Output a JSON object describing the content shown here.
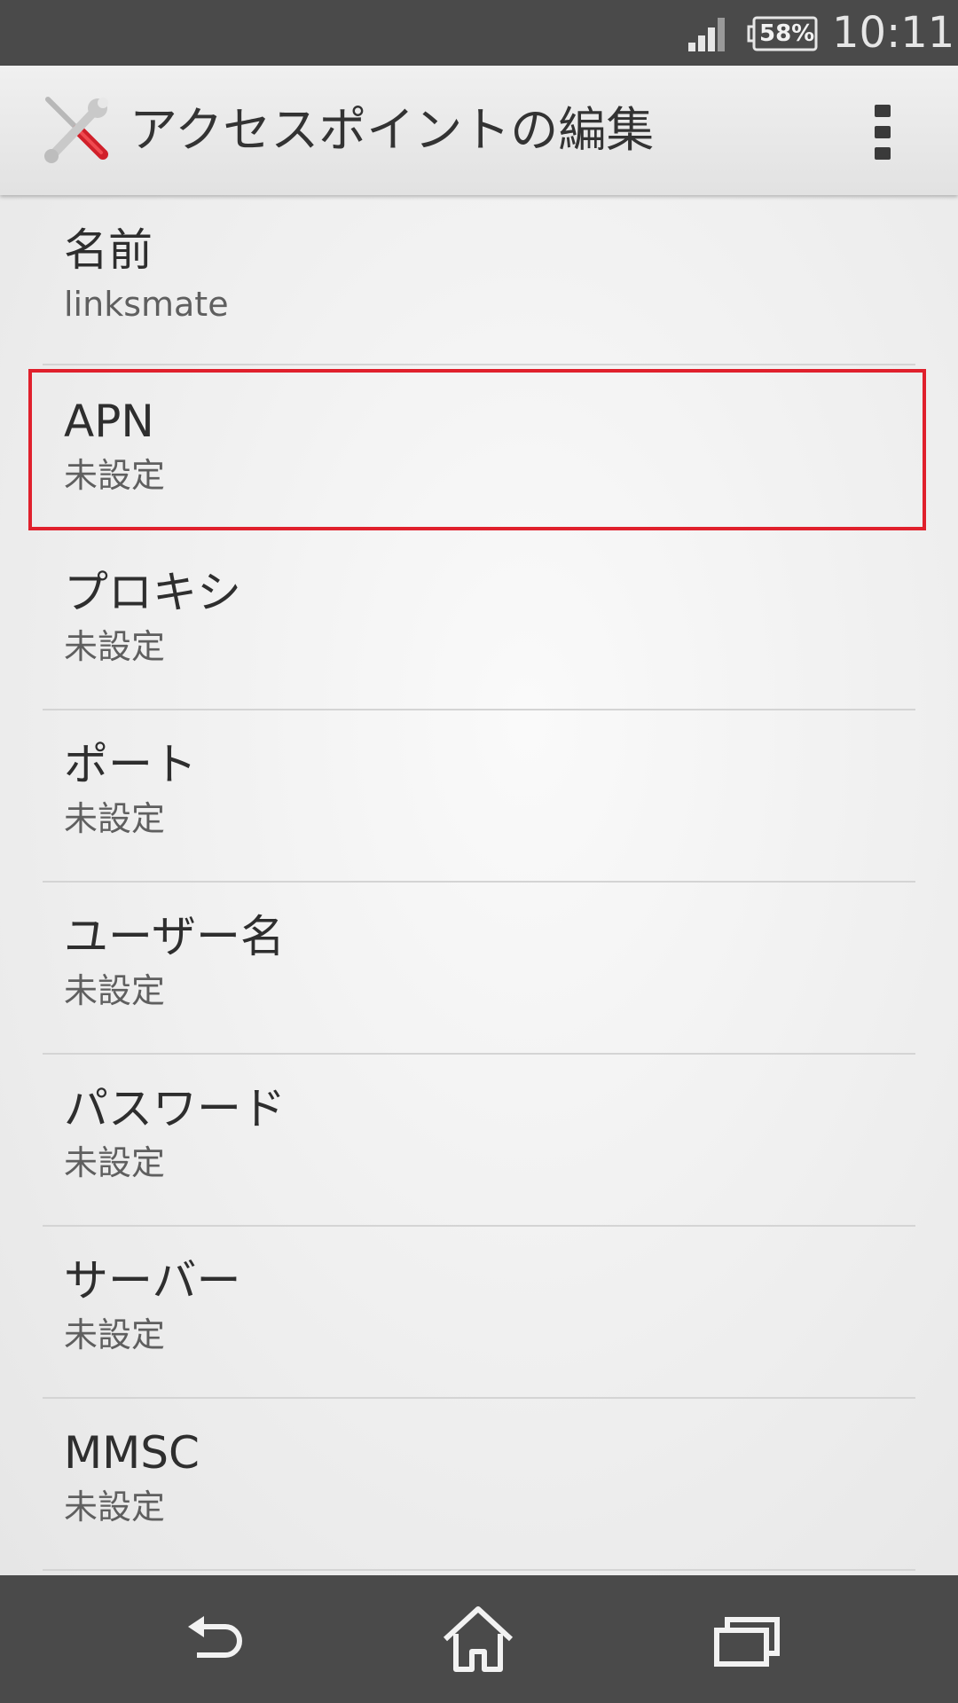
{
  "status_bar": {
    "battery_level": "58%",
    "time": "10:11",
    "icons": [
      "signal-icon",
      "battery-icon"
    ]
  },
  "action_bar": {
    "title": "アクセスポイントの編集",
    "icons": [
      "settings-tools-icon",
      "overflow-menu-icon"
    ]
  },
  "preferences": [
    {
      "title": "名前",
      "summary": "linksmate"
    },
    {
      "title": "APN",
      "summary": "未設定"
    },
    {
      "title": "プロキシ",
      "summary": "未設定"
    },
    {
      "title": "ポート",
      "summary": "未設定"
    },
    {
      "title": "ユーザー名",
      "summary": "未設定"
    },
    {
      "title": "パスワード",
      "summary": "未設定"
    },
    {
      "title": "サーバー",
      "summary": "未設定"
    },
    {
      "title": "MMSC",
      "summary": "未設定"
    }
  ],
  "highlight": {
    "item": "APN",
    "color": "#e0202c"
  },
  "nav_bar": {
    "icons": [
      "back-icon",
      "home-icon",
      "recents-icon"
    ]
  },
  "colors": {
    "status_bar": "#4a4a4a",
    "nav_bar": "#4a4a4a",
    "highlight": "#e0202c"
  }
}
